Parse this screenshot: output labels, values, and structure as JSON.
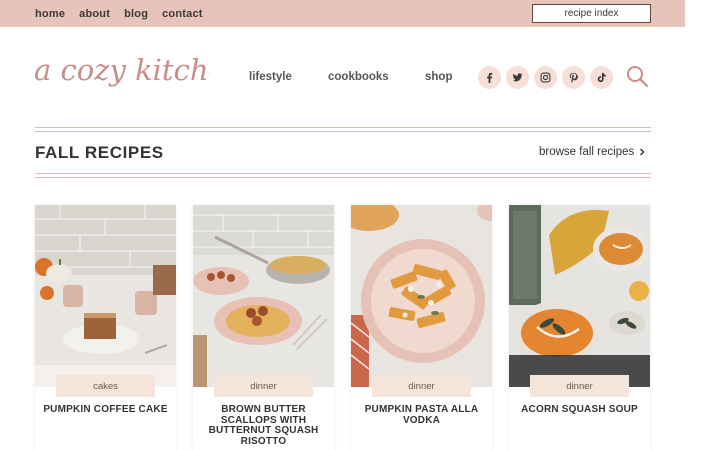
{
  "topnav": {
    "links": [
      "home",
      "about",
      "blog",
      "contact"
    ],
    "recipe_index": "recipe index"
  },
  "header": {
    "logo_text": "a cozy kitchen",
    "nav": [
      "lifestyle",
      "cookbooks",
      "shop"
    ],
    "social_icons": [
      "facebook-icon",
      "twitter-icon",
      "instagram-icon",
      "pinterest-icon",
      "tiktok-icon"
    ]
  },
  "section": {
    "title": "FALL RECIPES",
    "browse_label": "browse fall recipes"
  },
  "cards": [
    {
      "tag": "cakes",
      "title": "PUMPKIN COFFEE CAKE"
    },
    {
      "tag": "dinner",
      "title": "BROWN BUTTER SCALLOPS WITH BUTTERNUT SQUASH RISOTTO"
    },
    {
      "tag": "dinner",
      "title": "PUMPKIN PASTA ALLA VODKA"
    },
    {
      "tag": "dinner",
      "title": "ACORN SQUASH SOUP"
    }
  ],
  "colors": {
    "topbar": "#e7c4b9",
    "logo": "#c98e8a",
    "social_bg": "#f5dfd6",
    "tag_bg": "#f5e4d9",
    "rule": "#e5b9b3"
  }
}
